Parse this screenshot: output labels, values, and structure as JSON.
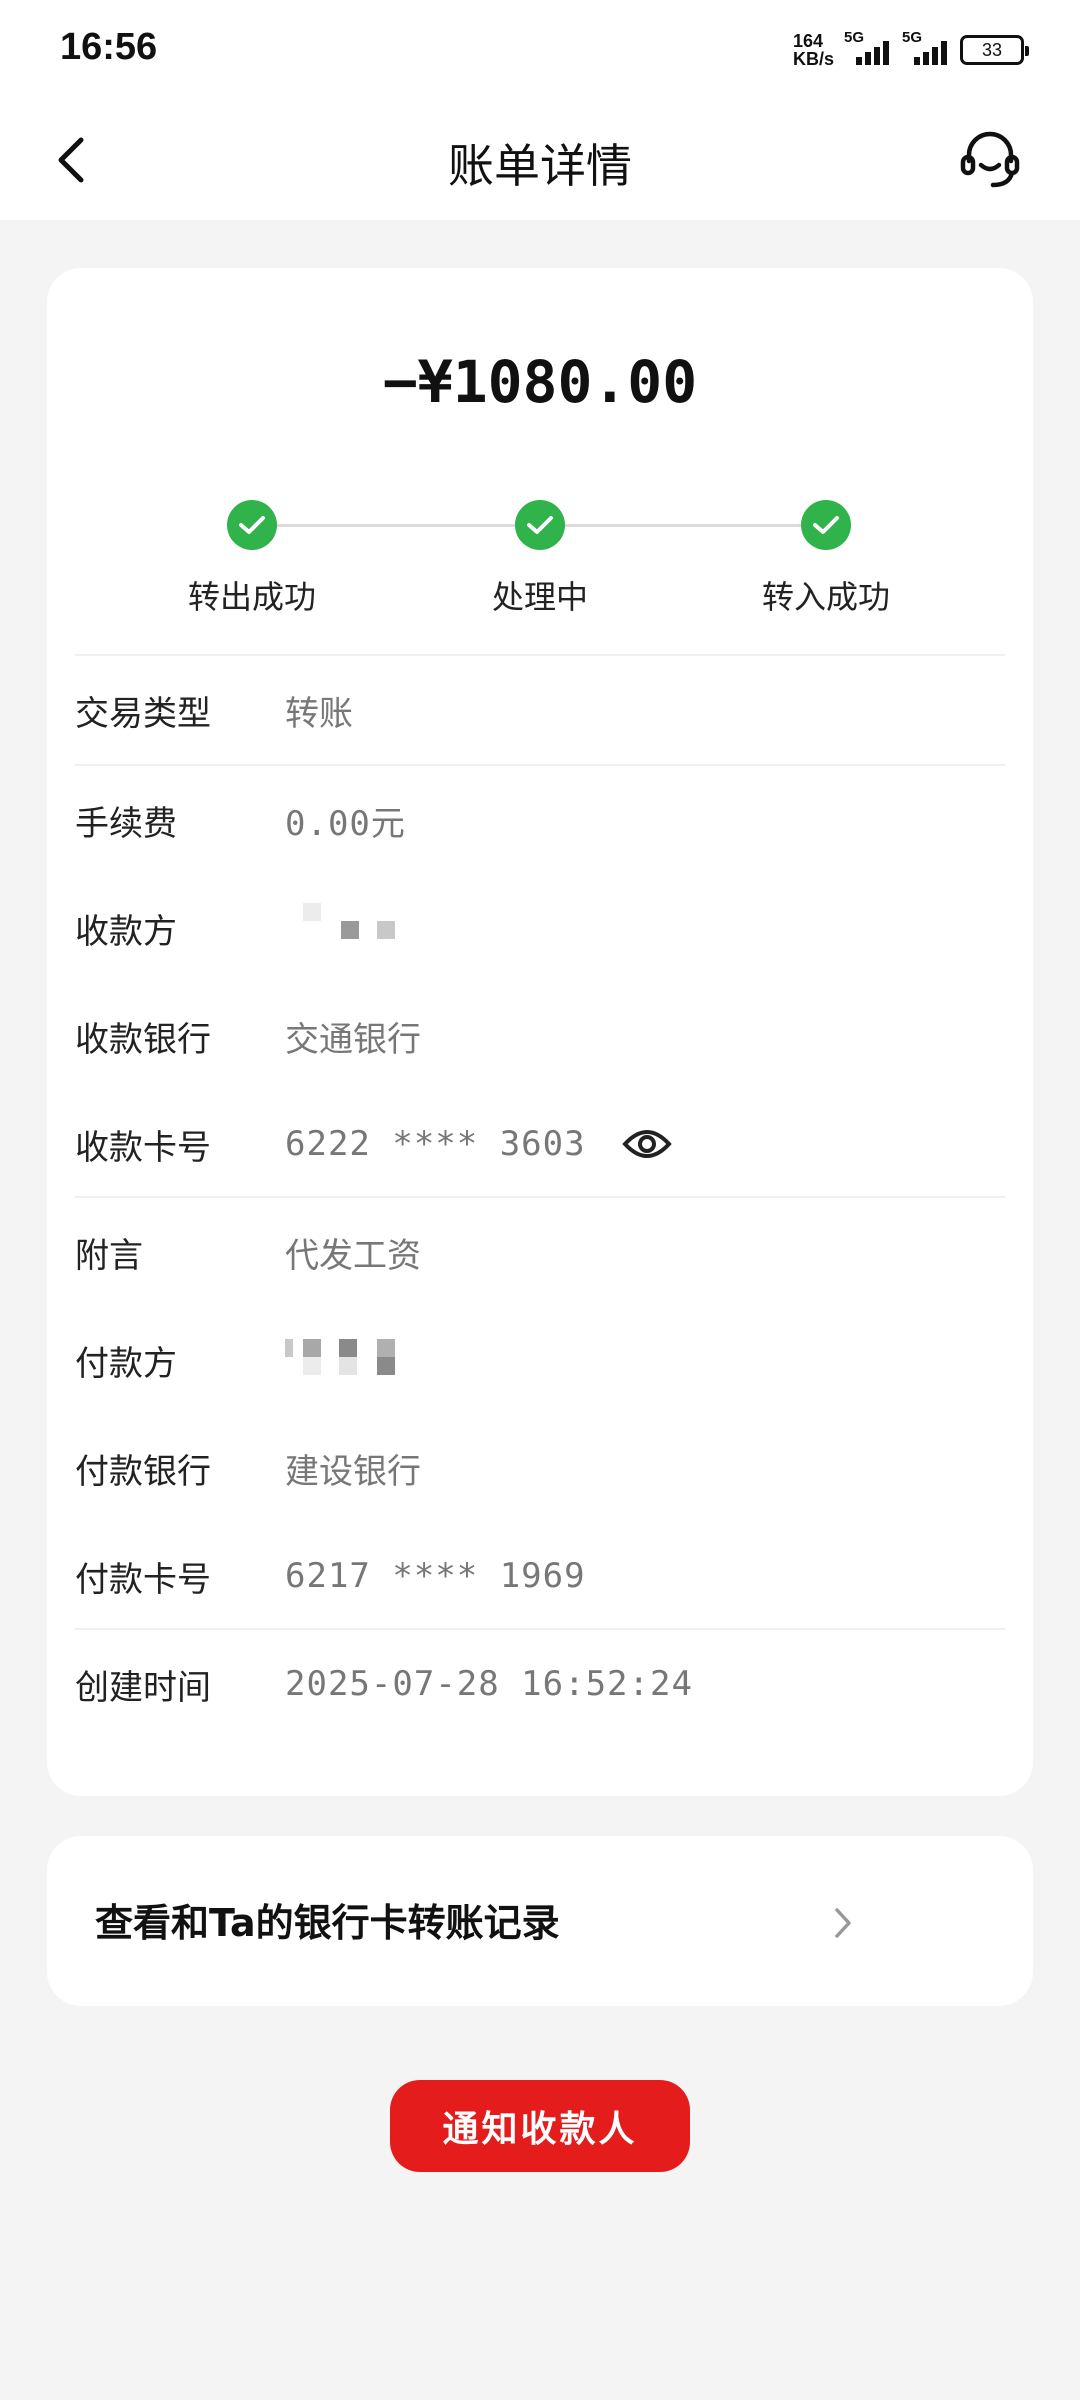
{
  "status_bar": {
    "time": "16:56",
    "net_speed_value": "164",
    "net_speed_unit": "KB/s",
    "sim1_label": "5G",
    "sim2_label": "5G",
    "battery": "33"
  },
  "nav": {
    "title": "账单详情",
    "back_icon": "chevron-left-icon",
    "support_icon": "headset-icon"
  },
  "bill": {
    "amount": "−¥1080.00",
    "steps": [
      {
        "label": "转出成功"
      },
      {
        "label": "处理中"
      },
      {
        "label": "转入成功"
      }
    ],
    "rows": [
      {
        "key": "交易类型",
        "value": "转账"
      },
      {
        "key": "手续费",
        "value": "0.00元"
      },
      {
        "key": "收款方",
        "value": ""
      },
      {
        "key": "收款银行",
        "value": "交通银行"
      },
      {
        "key": "收款卡号",
        "value": "6222 **** 3603"
      },
      {
        "key": "附言",
        "value": "代发工资"
      },
      {
        "key": "付款方",
        "value": ""
      },
      {
        "key": "付款银行",
        "value": "建设银行"
      },
      {
        "key": "付款卡号",
        "value": "6217 **** 1969"
      },
      {
        "key": "创建时间",
        "value": "2025-07-28 16:52:24"
      }
    ]
  },
  "link": {
    "text": "查看和Ta的银行卡转账记录"
  },
  "actions": {
    "notify_label": "通知收款人"
  },
  "colors": {
    "brand_red": "#e51c1c",
    "success_green": "#2fb34a"
  }
}
